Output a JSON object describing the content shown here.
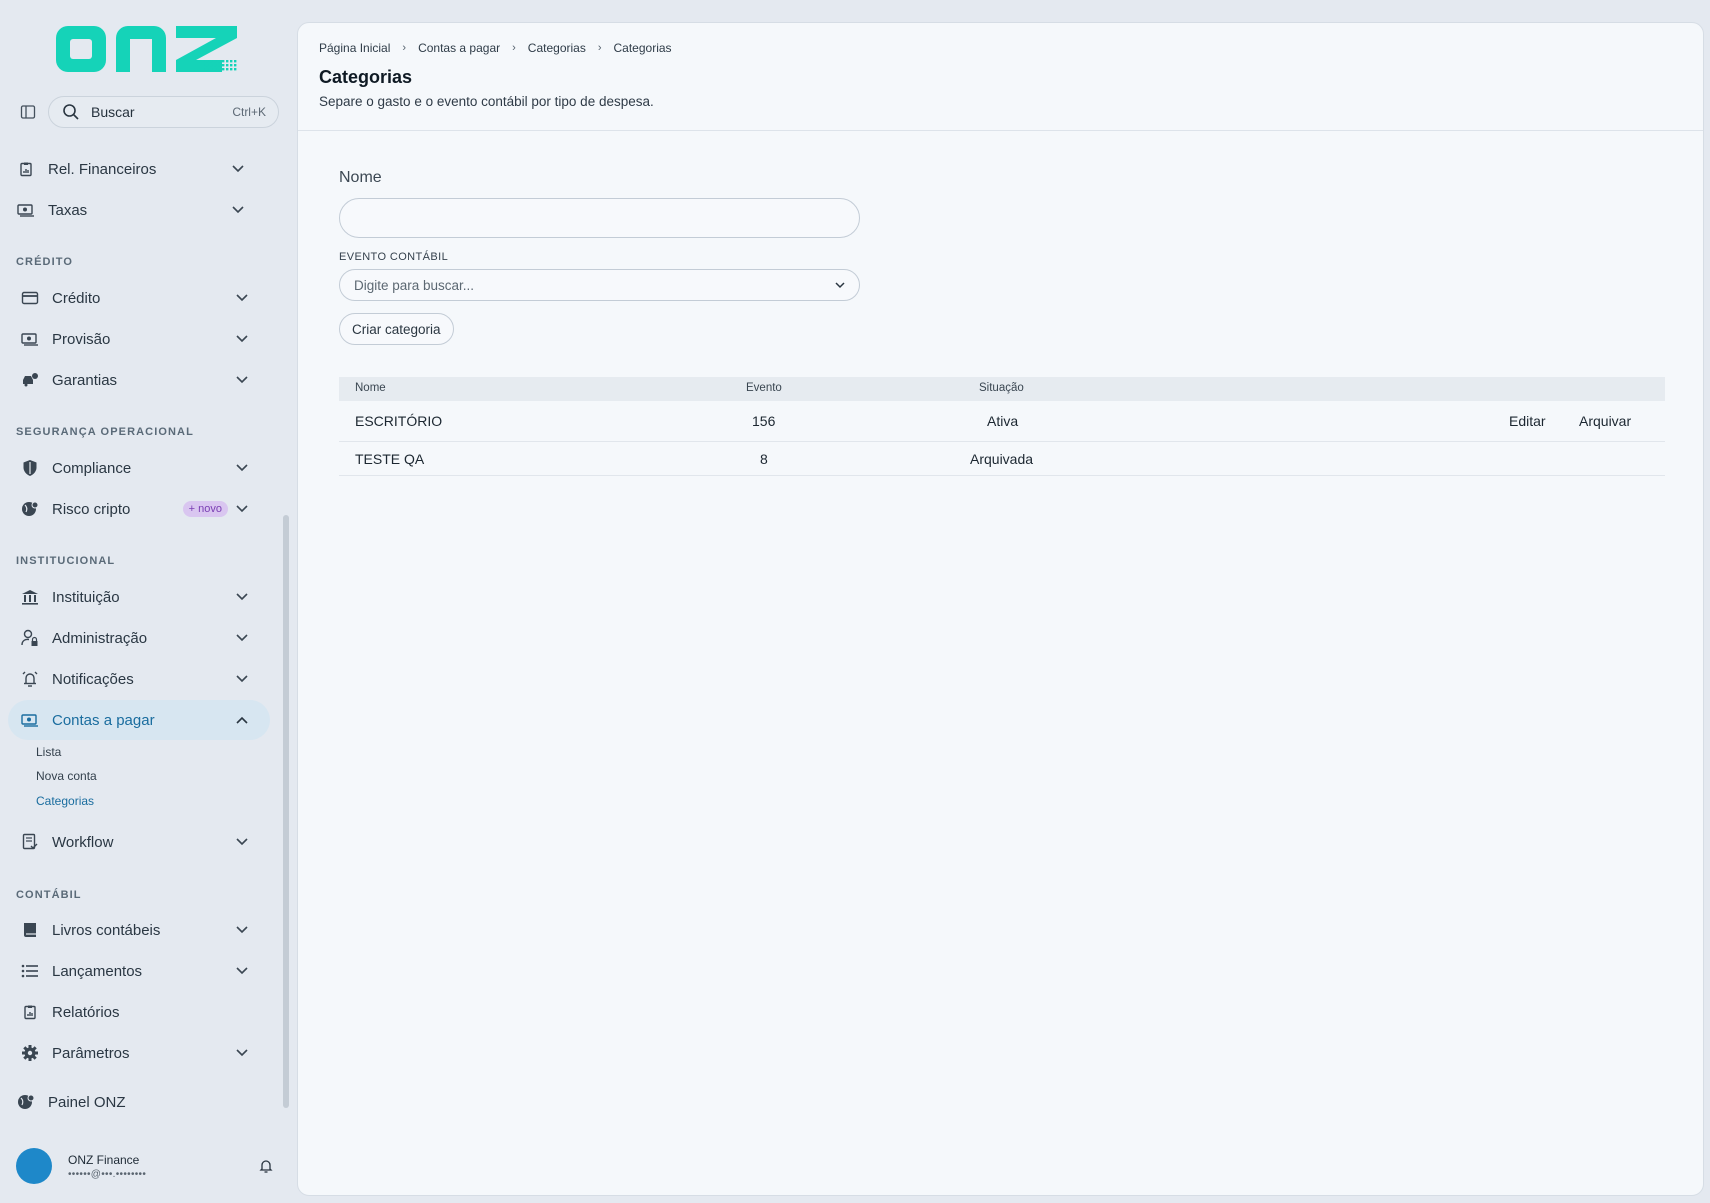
{
  "brand": {
    "logo_text": "onz",
    "accent": "#15d3b8"
  },
  "search": {
    "placeholder": "Buscar",
    "shortcut": "Ctrl+K"
  },
  "sidebar": {
    "top_items": [
      {
        "label": "Rel. Financeiros",
        "icon": "report-icon"
      },
      {
        "label": "Taxas",
        "icon": "money-icon"
      }
    ],
    "sections": {
      "credito": "CRÉDITO",
      "seguranca": "SEGURANÇA OPERACIONAL",
      "institucional": "INSTITUCIONAL",
      "contabil": "CONTÁBIL"
    },
    "items": {
      "credito": "Crédito",
      "provisao": "Provisão",
      "garantias": "Garantias",
      "compliance": "Compliance",
      "risco": "Risco cripto",
      "risco_badge": "+ novo",
      "instituicao": "Instituição",
      "administracao": "Administração",
      "notificacoes": "Notificações",
      "contas": "Contas a pagar",
      "workflow": "Workflow",
      "livros": "Livros contábeis",
      "lancamentos": "Lançamentos",
      "relatorios": "Relatórios",
      "parametros": "Parâmetros",
      "painel": "Painel ONZ"
    },
    "subitems": {
      "lista": "Lista",
      "nova": "Nova conta",
      "categorias": "Categorias"
    }
  },
  "user": {
    "name": "ONZ Finance",
    "email": "••••••@•••.••••••••"
  },
  "breadcrumb": [
    "Página Inicial",
    "Contas a pagar",
    "Categorias",
    "Categorias"
  ],
  "page": {
    "title": "Categorias",
    "subtitle": "Separe o gasto e o evento contábil por tipo de despesa."
  },
  "form": {
    "name_label": "Nome",
    "name_value": "",
    "event_label": "EVENTO CONTÁBIL",
    "event_placeholder": "Digite para buscar...",
    "create_label": "Criar categoria"
  },
  "table": {
    "headers": {
      "nome": "Nome",
      "evento": "Evento",
      "situacao": "Situação"
    },
    "rows": [
      {
        "nome": "ESCRITÓRIO",
        "evento": "156",
        "situacao": "Ativa",
        "edit": "Editar",
        "archive": "Arquivar"
      },
      {
        "nome": "TESTE QA",
        "evento": "8",
        "situacao": "Arquivada"
      }
    ]
  }
}
